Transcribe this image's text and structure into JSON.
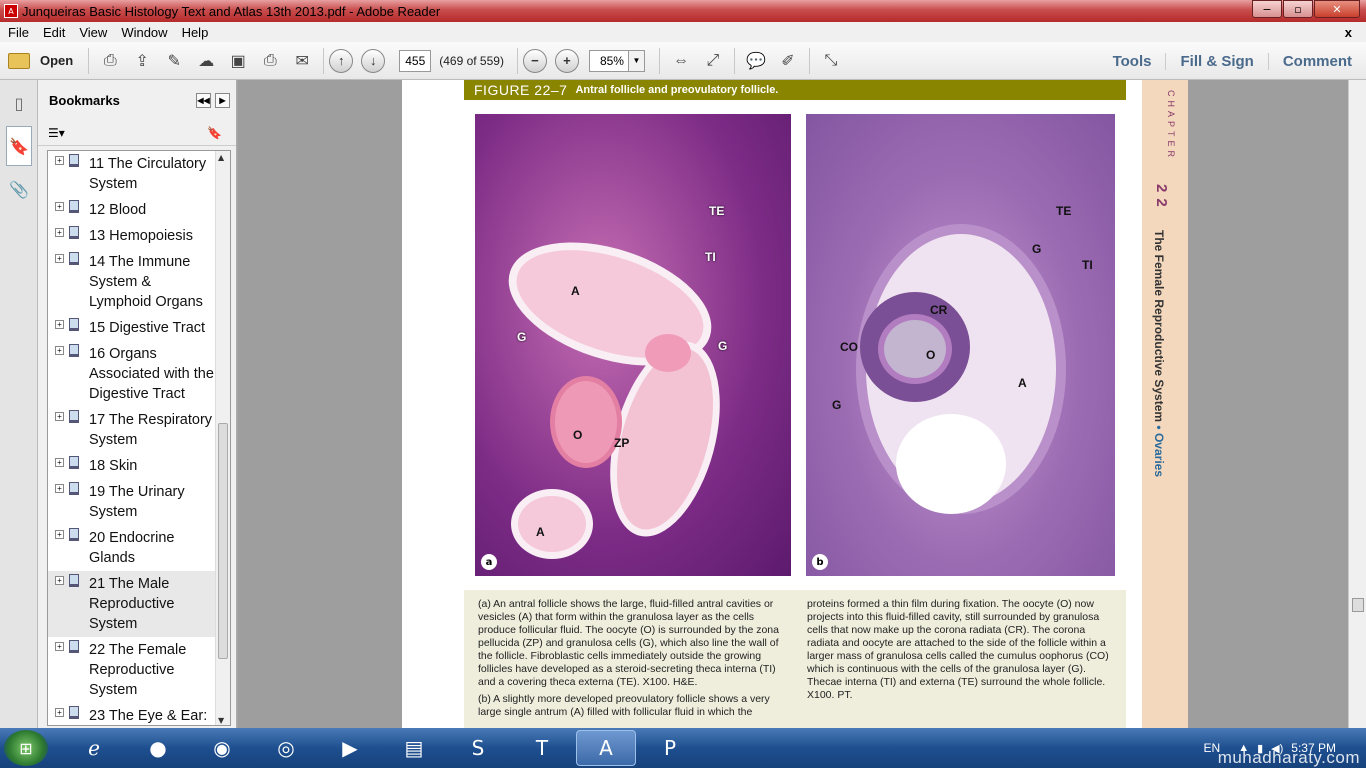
{
  "window": {
    "title": "Junqueiras Basic Histology Text and Atlas 13th 2013.pdf - Adobe Reader",
    "icon": "adobe-reader-icon"
  },
  "window_controls": {
    "minimize": "−",
    "maximize": "▫",
    "close": "✕"
  },
  "menu": {
    "items": [
      "File",
      "Edit",
      "View",
      "Window",
      "Help"
    ],
    "close_doc": "x"
  },
  "toolbar": {
    "open_label": "Open",
    "page_number": "455",
    "page_count": "(469 of 559)",
    "zoom": "85%",
    "right_links": [
      "Tools",
      "Fill & Sign",
      "Comment"
    ]
  },
  "bookmarks": {
    "title": "Bookmarks",
    "items": [
      {
        "label": "11 The Circulatory System"
      },
      {
        "label": "12 Blood"
      },
      {
        "label": "13 Hemopoiesis"
      },
      {
        "label": "14 The Immune System & Lymphoid Organs"
      },
      {
        "label": "15 Digestive Tract"
      },
      {
        "label": "16 Organs Associated with the Digestive Tract"
      },
      {
        "label": "17 The Respiratory System"
      },
      {
        "label": "18 Skin"
      },
      {
        "label": "19 The Urinary System"
      },
      {
        "label": "20 Endocrine Glands"
      },
      {
        "label": "21 The Male Reproductive System",
        "selected": true
      },
      {
        "label": "22 The Female Reproductive System"
      },
      {
        "label": "23 The Eye & Ear:"
      }
    ]
  },
  "document": {
    "figure_number": "FIGURE 22–7",
    "figure_title": "Antral follicle and preovulatory follicle.",
    "panel_a": {
      "id": "a",
      "labels": {
        "TE": "TE",
        "TI": "TI",
        "A1": "A",
        "G1": "G",
        "G2": "G",
        "O": "O",
        "ZP": "ZP",
        "A2": "A"
      }
    },
    "panel_b": {
      "id": "b",
      "labels": {
        "TE": "TE",
        "G1": "G",
        "TI": "TI",
        "CR": "CR",
        "CO": "CO",
        "O": "O",
        "A": "A",
        "G2": "G"
      }
    },
    "caption_a": "(a) An antral follicle shows the large, fluid-filled antral cavities or vesicles (A) that form within the granulosa layer as the cells produce follicular fluid. The oocyte (O) is surrounded by the zona pellucida (ZP) and granulosa cells (G), which also line the wall of the follicle. Fibroblastic cells immediately outside the growing follicles have developed as a steroid-secreting theca interna (TI) and a covering theca externa (TE). X100. H&E.",
    "caption_b_start": "(b) A slightly more developed preovulatory follicle shows a very large single antrum (A) filled with follicular fluid in which the",
    "caption_b_cont": "proteins formed a thin film during fixation. The oocyte (O) now projects into this fluid-filled cavity, still surrounded by granulosa cells that now make up the corona radiata (CR). The corona radiata and oocyte are attached to the side of the follicle within a larger mass of granulosa cells called the cumulus oophorus (CO) which is continuous with the cells of the granulosa layer (G). Thecae interna (TI) and externa (TE) surround the whole follicle. X100. PT.",
    "chapter_word": "CHAPTER",
    "chapter_number": "22",
    "chapter_title": "The Female Reproductive System",
    "chapter_bullet": "•",
    "chapter_section": "Ovaries"
  },
  "taskbar": {
    "apps": [
      "internet-explorer-icon",
      "orange-app-icon",
      "firefox-icon",
      "chrome-icon",
      "media-player-icon",
      "file-explorer-icon",
      "skype-icon",
      "t-app-icon",
      "adobe-reader-icon",
      "powerpoint-icon"
    ],
    "language": "EN",
    "time": "5:37 PM"
  },
  "watermark": "muhadharaty.com"
}
